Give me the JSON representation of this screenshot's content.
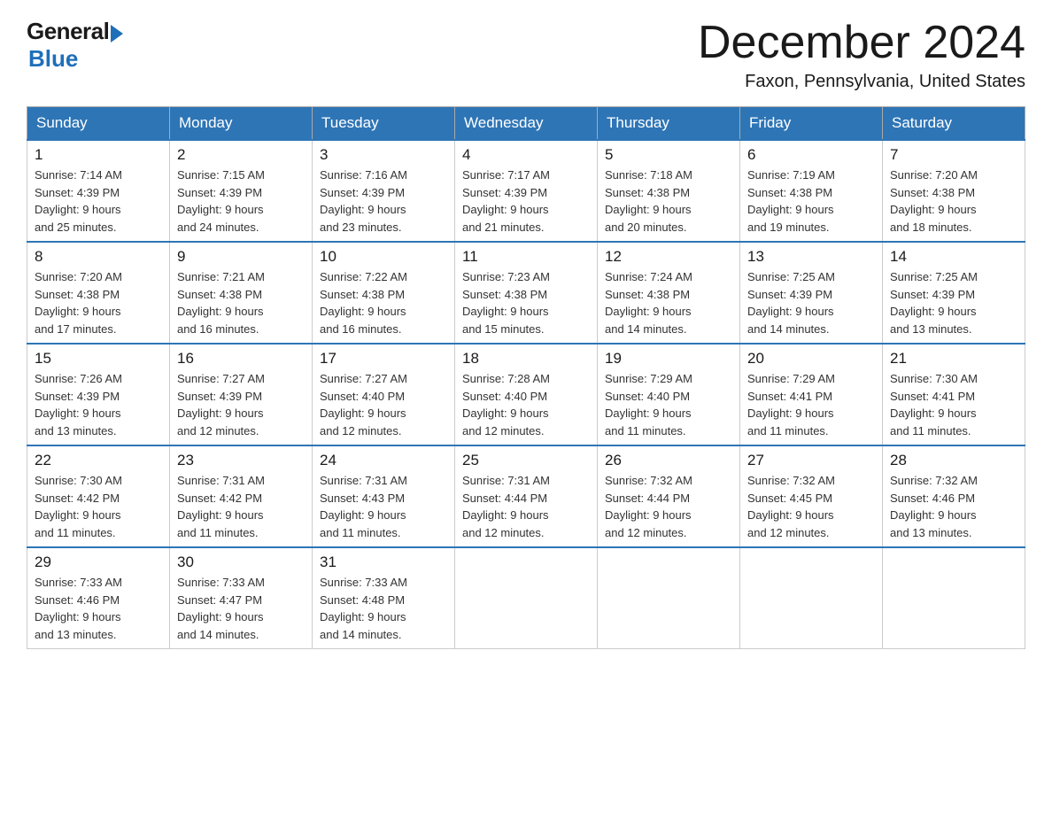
{
  "logo": {
    "general": "General",
    "blue": "Blue"
  },
  "title": "December 2024",
  "subtitle": "Faxon, Pennsylvania, United States",
  "days_of_week": [
    "Sunday",
    "Monday",
    "Tuesday",
    "Wednesday",
    "Thursday",
    "Friday",
    "Saturday"
  ],
  "weeks": [
    [
      {
        "num": "1",
        "sunrise": "7:14 AM",
        "sunset": "4:39 PM",
        "daylight": "9 hours and 25 minutes."
      },
      {
        "num": "2",
        "sunrise": "7:15 AM",
        "sunset": "4:39 PM",
        "daylight": "9 hours and 24 minutes."
      },
      {
        "num": "3",
        "sunrise": "7:16 AM",
        "sunset": "4:39 PM",
        "daylight": "9 hours and 23 minutes."
      },
      {
        "num": "4",
        "sunrise": "7:17 AM",
        "sunset": "4:39 PM",
        "daylight": "9 hours and 21 minutes."
      },
      {
        "num": "5",
        "sunrise": "7:18 AM",
        "sunset": "4:38 PM",
        "daylight": "9 hours and 20 minutes."
      },
      {
        "num": "6",
        "sunrise": "7:19 AM",
        "sunset": "4:38 PM",
        "daylight": "9 hours and 19 minutes."
      },
      {
        "num": "7",
        "sunrise": "7:20 AM",
        "sunset": "4:38 PM",
        "daylight": "9 hours and 18 minutes."
      }
    ],
    [
      {
        "num": "8",
        "sunrise": "7:20 AM",
        "sunset": "4:38 PM",
        "daylight": "9 hours and 17 minutes."
      },
      {
        "num": "9",
        "sunrise": "7:21 AM",
        "sunset": "4:38 PM",
        "daylight": "9 hours and 16 minutes."
      },
      {
        "num": "10",
        "sunrise": "7:22 AM",
        "sunset": "4:38 PM",
        "daylight": "9 hours and 16 minutes."
      },
      {
        "num": "11",
        "sunrise": "7:23 AM",
        "sunset": "4:38 PM",
        "daylight": "9 hours and 15 minutes."
      },
      {
        "num": "12",
        "sunrise": "7:24 AM",
        "sunset": "4:38 PM",
        "daylight": "9 hours and 14 minutes."
      },
      {
        "num": "13",
        "sunrise": "7:25 AM",
        "sunset": "4:39 PM",
        "daylight": "9 hours and 14 minutes."
      },
      {
        "num": "14",
        "sunrise": "7:25 AM",
        "sunset": "4:39 PM",
        "daylight": "9 hours and 13 minutes."
      }
    ],
    [
      {
        "num": "15",
        "sunrise": "7:26 AM",
        "sunset": "4:39 PM",
        "daylight": "9 hours and 13 minutes."
      },
      {
        "num": "16",
        "sunrise": "7:27 AM",
        "sunset": "4:39 PM",
        "daylight": "9 hours and 12 minutes."
      },
      {
        "num": "17",
        "sunrise": "7:27 AM",
        "sunset": "4:40 PM",
        "daylight": "9 hours and 12 minutes."
      },
      {
        "num": "18",
        "sunrise": "7:28 AM",
        "sunset": "4:40 PM",
        "daylight": "9 hours and 12 minutes."
      },
      {
        "num": "19",
        "sunrise": "7:29 AM",
        "sunset": "4:40 PM",
        "daylight": "9 hours and 11 minutes."
      },
      {
        "num": "20",
        "sunrise": "7:29 AM",
        "sunset": "4:41 PM",
        "daylight": "9 hours and 11 minutes."
      },
      {
        "num": "21",
        "sunrise": "7:30 AM",
        "sunset": "4:41 PM",
        "daylight": "9 hours and 11 minutes."
      }
    ],
    [
      {
        "num": "22",
        "sunrise": "7:30 AM",
        "sunset": "4:42 PM",
        "daylight": "9 hours and 11 minutes."
      },
      {
        "num": "23",
        "sunrise": "7:31 AM",
        "sunset": "4:42 PM",
        "daylight": "9 hours and 11 minutes."
      },
      {
        "num": "24",
        "sunrise": "7:31 AM",
        "sunset": "4:43 PM",
        "daylight": "9 hours and 11 minutes."
      },
      {
        "num": "25",
        "sunrise": "7:31 AM",
        "sunset": "4:44 PM",
        "daylight": "9 hours and 12 minutes."
      },
      {
        "num": "26",
        "sunrise": "7:32 AM",
        "sunset": "4:44 PM",
        "daylight": "9 hours and 12 minutes."
      },
      {
        "num": "27",
        "sunrise": "7:32 AM",
        "sunset": "4:45 PM",
        "daylight": "9 hours and 12 minutes."
      },
      {
        "num": "28",
        "sunrise": "7:32 AM",
        "sunset": "4:46 PM",
        "daylight": "9 hours and 13 minutes."
      }
    ],
    [
      {
        "num": "29",
        "sunrise": "7:33 AM",
        "sunset": "4:46 PM",
        "daylight": "9 hours and 13 minutes."
      },
      {
        "num": "30",
        "sunrise": "7:33 AM",
        "sunset": "4:47 PM",
        "daylight": "9 hours and 14 minutes."
      },
      {
        "num": "31",
        "sunrise": "7:33 AM",
        "sunset": "4:48 PM",
        "daylight": "9 hours and 14 minutes."
      },
      null,
      null,
      null,
      null
    ]
  ],
  "labels": {
    "sunrise": "Sunrise:",
    "sunset": "Sunset:",
    "daylight": "Daylight:"
  }
}
